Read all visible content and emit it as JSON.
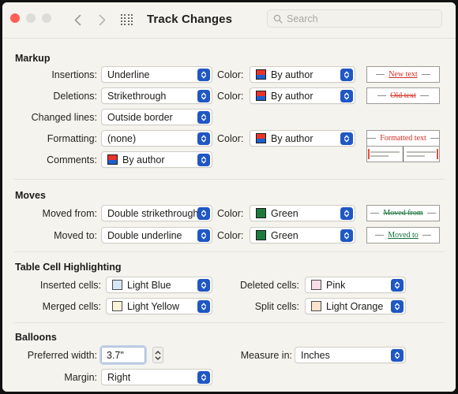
{
  "window": {
    "title": "Track Changes",
    "traffic_lights": [
      "close-red",
      "minimize-gray",
      "zoom-gray"
    ],
    "nav_back_icon": "chevron-left-icon",
    "nav_forward_icon": "chevron-right-icon",
    "grid_icon": "show-all-grid-icon",
    "search": {
      "placeholder": "Search",
      "value": "",
      "icon": "search-icon"
    }
  },
  "markup": {
    "heading": "Markup",
    "rows": [
      {
        "label": "Insertions:",
        "value": "Underline",
        "color_label": "Color:",
        "color_value": "By author",
        "swatch": "by-author",
        "preview_text": "New text",
        "preview_style": "ins"
      },
      {
        "label": "Deletions:",
        "value": "Strikethrough",
        "color_label": "Color:",
        "color_value": "By author",
        "swatch": "by-author",
        "preview_text": "Old text",
        "preview_style": "del"
      },
      {
        "label": "Changed lines:",
        "value": "Outside border",
        "preview_style": "lines"
      },
      {
        "label": "Formatting:",
        "value": "(none)",
        "color_label": "Color:",
        "color_value": "By author",
        "swatch": "by-author",
        "preview_text": "Formatted text",
        "preview_style": "fmt"
      },
      {
        "label": "Comments:",
        "value": "By author",
        "swatch": "by-author"
      }
    ]
  },
  "moves": {
    "heading": "Moves",
    "rows": [
      {
        "label": "Moved from:",
        "value": "Double strikethrough",
        "color_label": "Color:",
        "color_value": "Green",
        "swatch": "green",
        "preview_text": "Moved from",
        "preview_style": "mfrom"
      },
      {
        "label": "Moved to:",
        "value": "Double underline",
        "color_label": "Color:",
        "color_value": "Green",
        "swatch": "green",
        "preview_text": "Moved to",
        "preview_style": "mto"
      }
    ]
  },
  "table_cell_highlighting": {
    "heading": "Table Cell Highlighting",
    "rows": [
      {
        "label": "Inserted cells:",
        "value": "Light Blue",
        "swatch": "#d6e6f5",
        "right_label": "Deleted cells:",
        "right_value": "Pink",
        "right_swatch": "#f7dde7"
      },
      {
        "label": "Merged cells:",
        "value": "Light Yellow",
        "swatch": "#fbf3d8",
        "right_label": "Split cells:",
        "right_value": "Light Orange",
        "right_swatch": "#fbe2cb"
      }
    ]
  },
  "balloons": {
    "heading": "Balloons",
    "preferred_width_label": "Preferred width:",
    "preferred_width_value": "3.7\"",
    "stepper_icon": "stepper-up-down-icon",
    "measure_label": "Measure in:",
    "measure_value": "Inches",
    "margin_label": "Margin:",
    "margin_value": "Right"
  },
  "colors": {
    "accent": "#1f57c3",
    "insertion": "#d42b23",
    "move": "#13703a",
    "background": "#f4f3ee"
  }
}
